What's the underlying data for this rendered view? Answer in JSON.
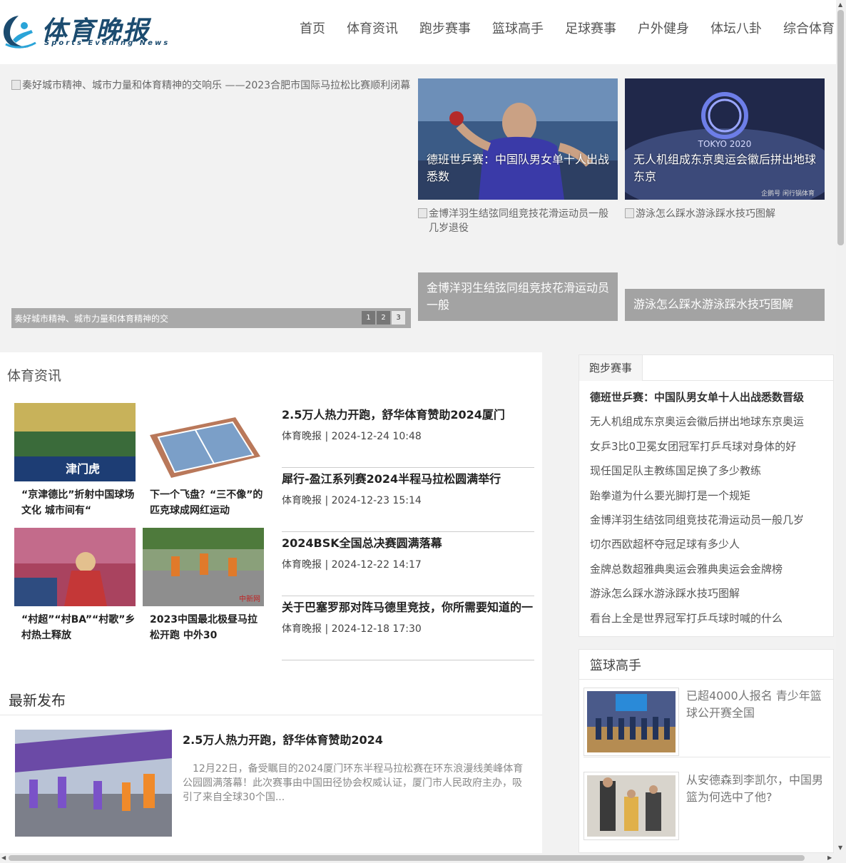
{
  "header": {
    "logo_title": "体育晚报",
    "logo_sub": "Sports Evening News",
    "nav": [
      "首页",
      "体育资讯",
      "跑步赛事",
      "篮球高手",
      "足球赛事",
      "户外健身",
      "体坛八卦",
      "综合体育"
    ]
  },
  "hero": {
    "main_alt": "奏好城市精神、城市力量和体育精神的交响乐 ——2023合肥市国际马拉松比赛顺利闭幕",
    "main_caption": "奏好城市精神、城市力量和体育精神的交",
    "pager": [
      "1",
      "2",
      "3"
    ],
    "cards": [
      {
        "caption": "德班世乒赛：中国队男女单十人出战悉数"
      },
      {
        "caption": "无人机组成东京奥运会徽后拼出地球东京",
        "image_text": "TOKYO 2020",
        "watermark": "企鹅号 闲行锅体育"
      },
      {
        "alt": "金博洋羽生结弦同组竞技花滑运动员一般几岁退役",
        "caption": "金博洋羽生结弦同组竞技花滑运动员一般"
      },
      {
        "alt": "游泳怎么踩水游泳踩水技巧图解",
        "caption": "游泳怎么踩水游泳踩水技巧图解"
      }
    ]
  },
  "sports_news": {
    "title": "体育资讯",
    "thumbs": [
      {
        "caption": "“京津德比”折射中国球场文化 城市间有“",
        "image_text": "津门虎"
      },
      {
        "caption": "下一个飞盘？“三不像”的匹克球成网红运动"
      },
      {
        "caption": "“村超”“村BA”“村歌”乡村热土释放"
      },
      {
        "caption": "2023中国最北极昼马拉松开跑 中外30",
        "watermark": "中新网"
      }
    ],
    "list": [
      {
        "title": "2.5万人热力开跑，舒华体育赞助2024厦门",
        "meta": "体育晚报 | 2024-12-24 10:48"
      },
      {
        "title": "犀行-盈江系列赛2024半程马拉松圆满举行",
        "meta": "体育晚报 | 2024-12-23 15:14"
      },
      {
        "title": "2024BSK全国总决赛圆满落幕",
        "meta": "体育晚报 | 2024-12-22 14:17"
      },
      {
        "title": "关于巴塞罗那对阵马德里竞技，你所需要知道的一",
        "meta": "体育晚报 | 2024-12-18 17:30"
      }
    ]
  },
  "latest": {
    "title": "最新发布",
    "item_title": "2.5万人热力开跑，舒华体育赞助2024",
    "item_desc": "12月22日，备受瞩目的2024厦门环东半程马拉松赛在环东浪漫线美峰体育公园圆满落幕！此次赛事由中国田径协会权威认证，厦门市人民政府主办，吸引了来自全球30个国..."
  },
  "sidebar": {
    "running": {
      "tab": "跑步赛事",
      "items": [
        "德班世乒赛：中国队男女单十人出战悉数晋级",
        "无人机组成东京奥运会徽后拼出地球东京奥运",
        "女乒3比0卫冕女团冠军打乒乓球对身体的好",
        "现任国足队主教练国足换了多少教练",
        "跆拳道为什么要光脚打是一个规矩",
        "金博洋羽生结弦同组竞技花滑运动员一般几岁",
        "切尔西欧超杯夺冠足球有多少人",
        "金牌总数超雅典奥运会雅典奥运会金牌榜",
        "游泳怎么踩水游泳踩水技巧图解",
        "看台上全是世界冠军打乒乓球时喊的什么"
      ]
    },
    "basketball": {
      "title": "篮球高手",
      "items": [
        {
          "text": "已超4000人报名 青少年篮球公开赛全国"
        },
        {
          "text": "从安德森到李凯尔，中国男篮为何选中了他?"
        }
      ]
    }
  }
}
